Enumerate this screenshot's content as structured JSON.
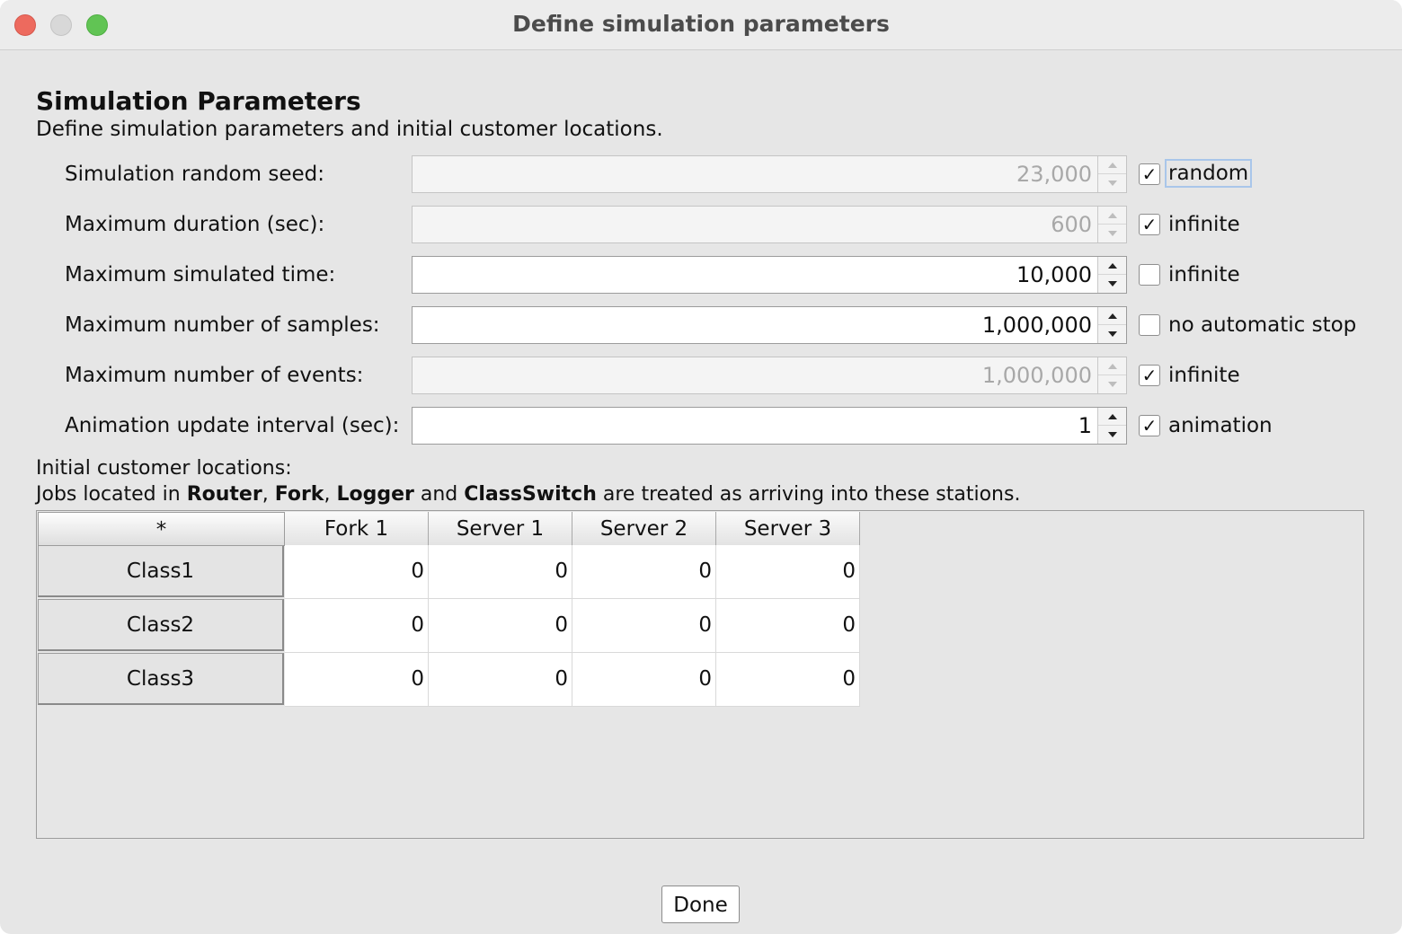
{
  "window": {
    "title": "Define simulation parameters"
  },
  "section": {
    "title": "Simulation Parameters",
    "subtitle": "Define simulation parameters and initial customer locations."
  },
  "params": [
    {
      "label": "Simulation random seed:",
      "value": "23,000",
      "enabled": false,
      "check_label": "random",
      "checked": true
    },
    {
      "label": "Maximum duration (sec):",
      "value": "600",
      "enabled": false,
      "check_label": "infinite",
      "checked": true
    },
    {
      "label": "Maximum simulated time:",
      "value": "10,000",
      "enabled": true,
      "check_label": "infinite",
      "checked": false
    },
    {
      "label": "Maximum number of samples:",
      "value": "1,000,000",
      "enabled": true,
      "check_label": "no automatic stop",
      "checked": false
    },
    {
      "label": "Maximum number of events:",
      "value": "1,000,000",
      "enabled": false,
      "check_label": "infinite",
      "checked": true
    },
    {
      "label": "Animation update interval (sec):",
      "value": "1",
      "enabled": true,
      "check_label": "animation",
      "checked": true
    }
  ],
  "locations": {
    "heading": "Initial customer locations:",
    "note_prefix": "Jobs located in ",
    "note_router": "Router",
    "note_sep1": ", ",
    "note_fork": "Fork",
    "note_sep2": ", ",
    "note_logger": "Logger",
    "note_and": " and ",
    "note_classswitch": "ClassSwitch",
    "note_suffix": " are treated as arriving into these stations.",
    "corner": "*",
    "columns": [
      "Fork 1",
      "Server 1",
      "Server 2",
      "Server 3"
    ],
    "rows": [
      {
        "name": "Class1",
        "values": [
          "0",
          "0",
          "0",
          "0"
        ]
      },
      {
        "name": "Class2",
        "values": [
          "0",
          "0",
          "0",
          "0"
        ]
      },
      {
        "name": "Class3",
        "values": [
          "0",
          "0",
          "0",
          "0"
        ]
      }
    ]
  },
  "footer": {
    "done_label": "Done"
  }
}
